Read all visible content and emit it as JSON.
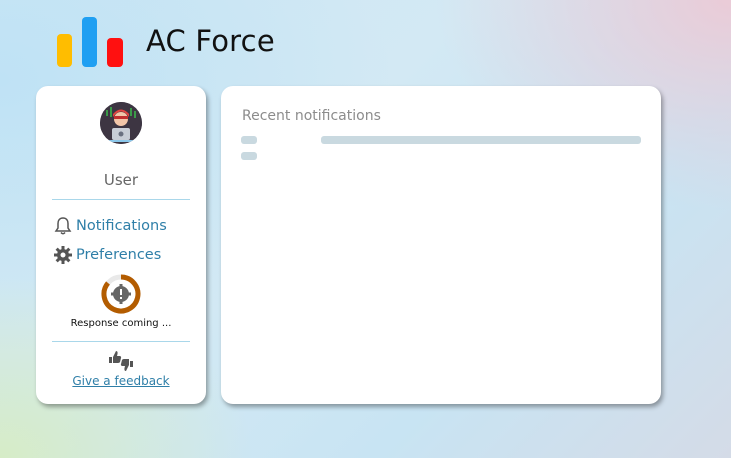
{
  "app": {
    "title": "AC Force"
  },
  "logo": {
    "colors": [
      "#ffbd00",
      "#1f9ff2",
      "#ff1010"
    ]
  },
  "sidebar": {
    "user_name": "User",
    "nav": [
      {
        "label": "Notifications",
        "icon": "bell-icon"
      },
      {
        "label": "Preferences",
        "icon": "gear-icon"
      }
    ],
    "status": {
      "text": "Response coming ...",
      "icon": "alert-gear-icon",
      "color": "#b35c00"
    },
    "feedback": {
      "label": "Give a feedback",
      "icon": "thumbs-up-down-icon"
    }
  },
  "main": {
    "title": "Recent notifications"
  }
}
